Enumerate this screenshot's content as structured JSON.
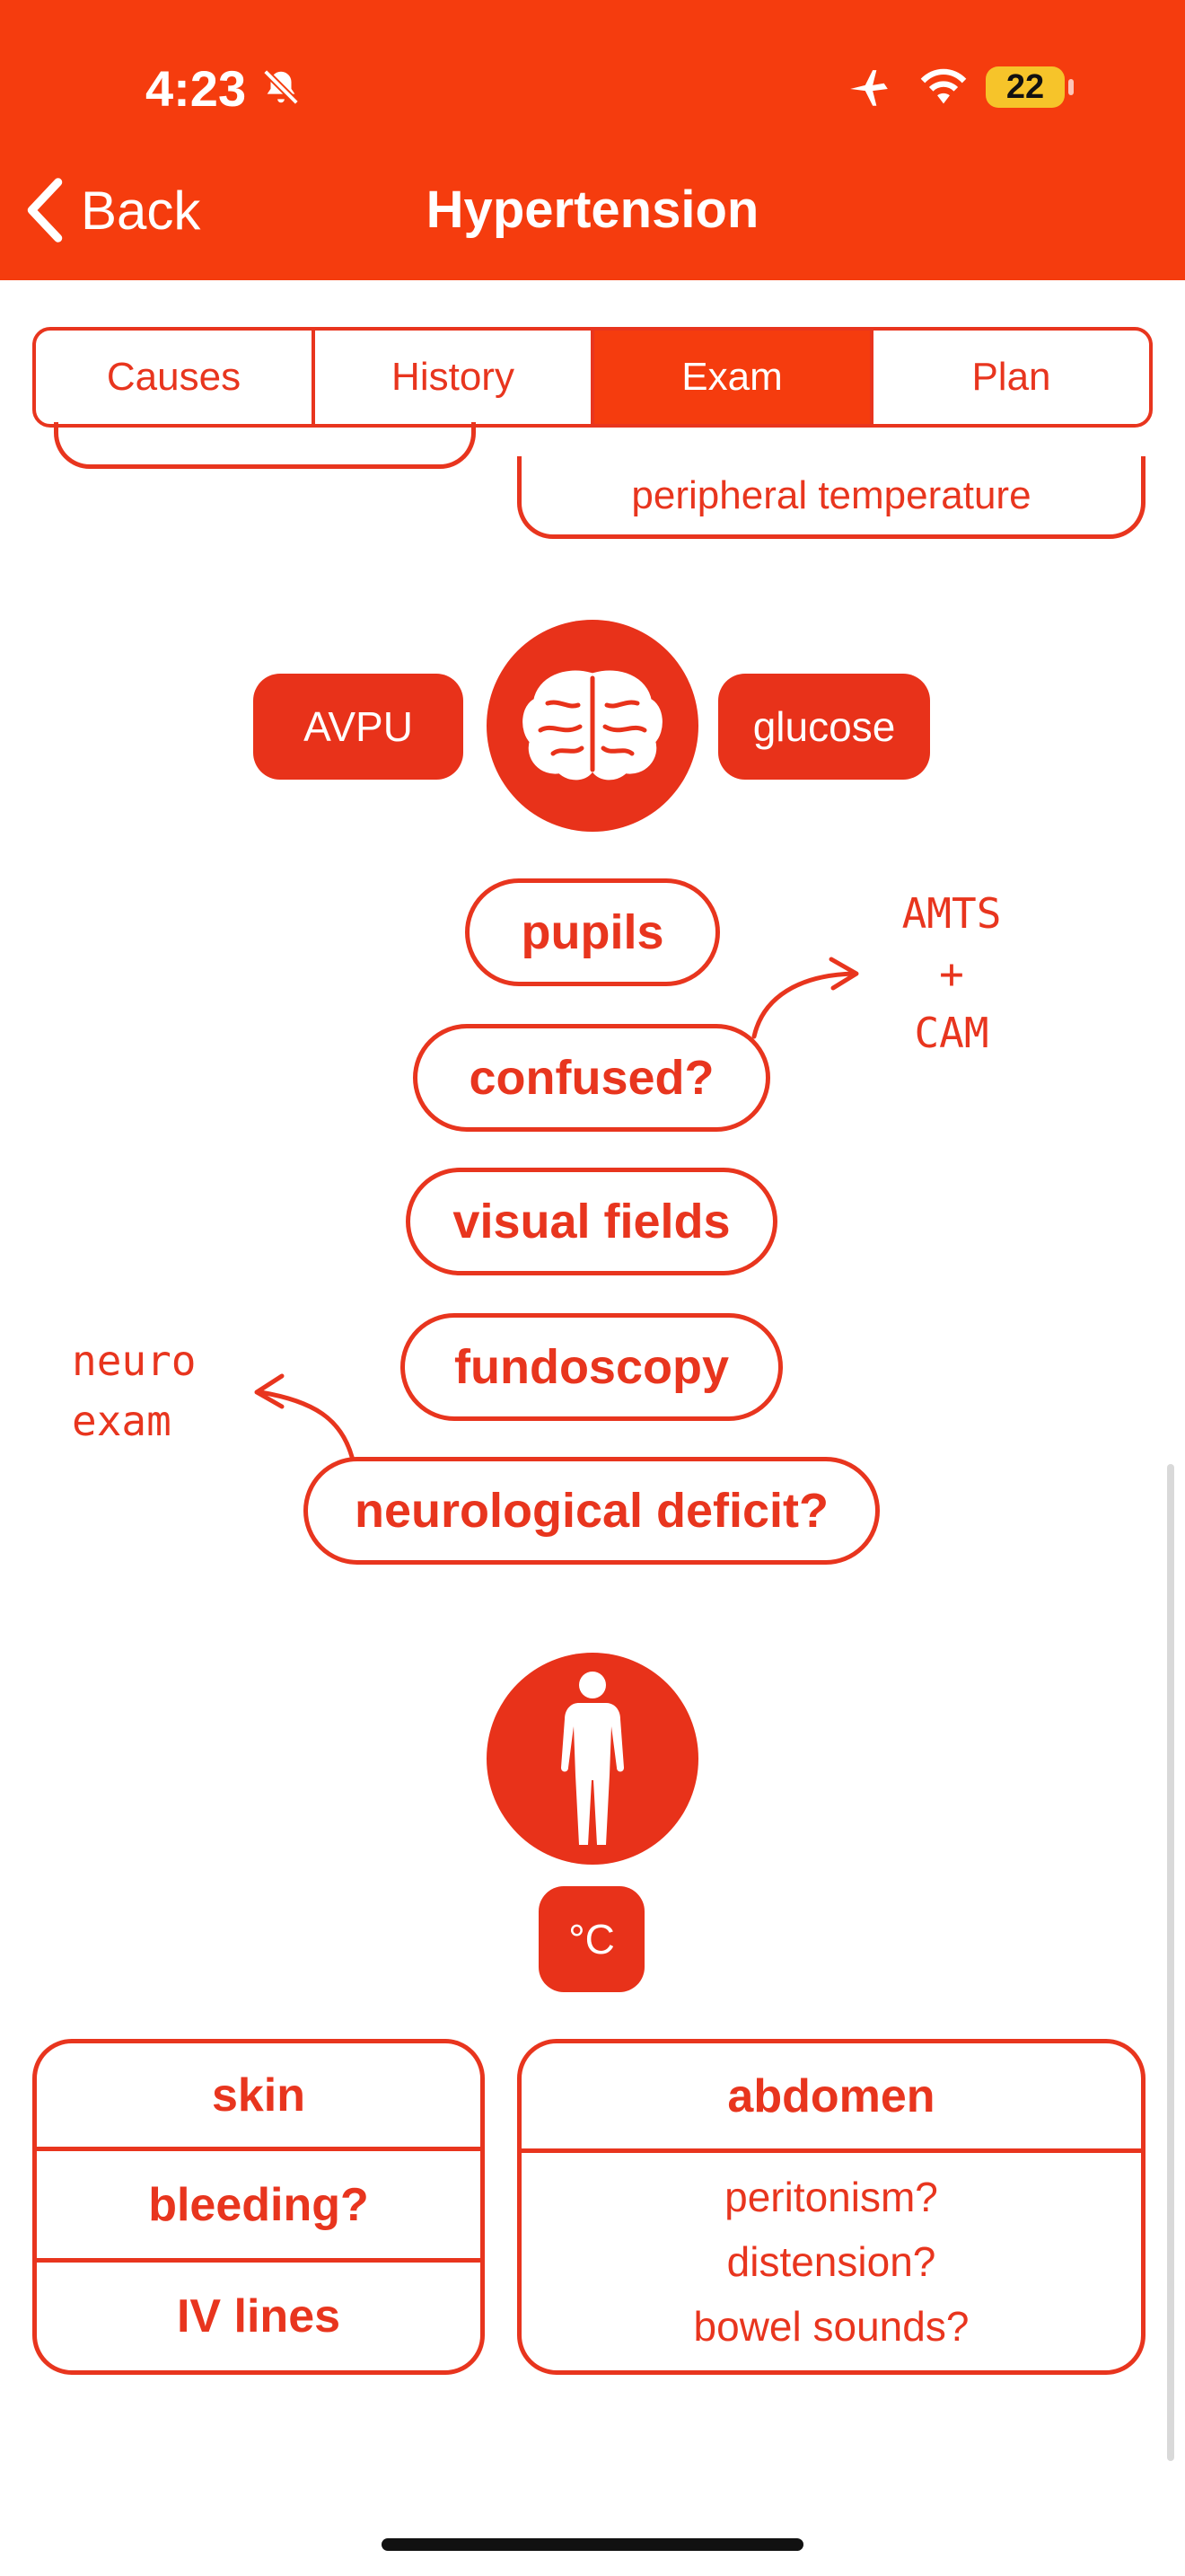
{
  "status_bar": {
    "time": "4:23",
    "battery": "22"
  },
  "nav": {
    "back_label": "Back",
    "title": "Hypertension"
  },
  "tabs": [
    {
      "label": "Causes",
      "active": false
    },
    {
      "label": "History",
      "active": false
    },
    {
      "label": "Exam",
      "active": true
    },
    {
      "label": "Plan",
      "active": false
    }
  ],
  "top_card": {
    "text": "peripheral temperature"
  },
  "neuro": {
    "left_badge": "AVPU",
    "right_badge": "glucose",
    "icon": "brain-icon",
    "items": [
      "pupils",
      "confused?",
      "visual fields",
      "fundoscopy",
      "neurological deficit?"
    ],
    "note_right": [
      "AMTS",
      "+",
      "CAM"
    ],
    "note_left": [
      "neuro",
      "exam"
    ]
  },
  "body": {
    "icon": "human-body-icon",
    "temp_badge": "°C",
    "left_card": [
      "skin",
      "bleeding?",
      "IV lines"
    ],
    "right_card": {
      "title": "abdomen",
      "items": [
        "peritonism?",
        "distension?",
        "bowel sounds?"
      ]
    }
  },
  "colors": {
    "accent": "#f53c0e",
    "red": "#e8351e"
  }
}
